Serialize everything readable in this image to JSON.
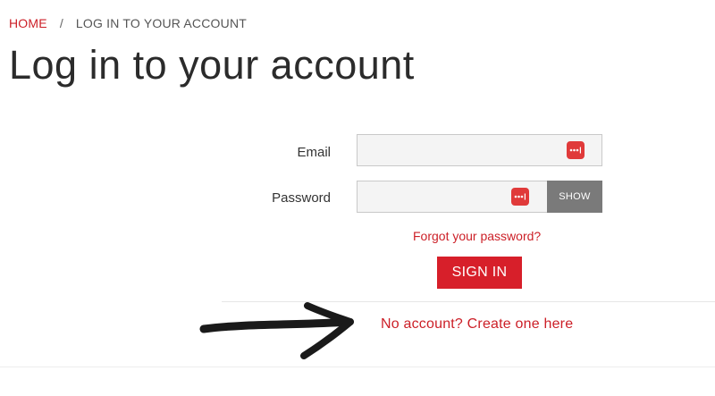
{
  "breadcrumb": {
    "home": "HOME",
    "separator": "/",
    "current": "LOG IN TO YOUR ACCOUNT"
  },
  "page_title": "Log in to your account",
  "form": {
    "email_label": "Email",
    "email_value": "",
    "password_label": "Password",
    "password_value": "",
    "show_label": "SHOW",
    "forgot_label": "Forgot your password?",
    "signin_label": "SIGN IN"
  },
  "create_account_label": "No account? Create one here",
  "icons": {
    "password_manager": "password-manager-icon",
    "annotation_arrow": "arrow-icon"
  },
  "colors": {
    "accent": "#cc1f27",
    "button": "#d71f2a",
    "show_button": "#7a7a7a",
    "field_bg": "#f4f4f4"
  }
}
